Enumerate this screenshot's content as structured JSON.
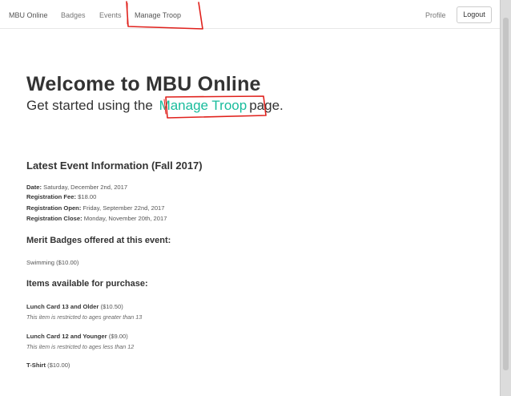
{
  "navbar": {
    "brand": "MBU Online",
    "links": [
      "Badges",
      "Events",
      "Manage Troop"
    ],
    "profile": "Profile",
    "logout": "Logout"
  },
  "jumbotron": {
    "title": "Welcome to MBU Online",
    "subtitle_prefix": "Get started using the",
    "subtitle_link": "Manage Troop",
    "subtitle_suffix": "page."
  },
  "event": {
    "heading": "Latest Event Information (Fall 2017)",
    "details": [
      {
        "label": "Date:",
        "value": "Saturday, December 2nd, 2017"
      },
      {
        "label": "Registration Fee:",
        "value": "$18.00"
      },
      {
        "label": "Registration Open:",
        "value": "Friday, September 22nd, 2017"
      },
      {
        "label": "Registration Close:",
        "value": "Monday, November 20th, 2017"
      }
    ]
  },
  "badges_section": {
    "heading": "Merit Badges offered at this event:",
    "items": [
      "Swimming ($10.00)"
    ]
  },
  "purchases_section": {
    "heading": "Items available for purchase:",
    "items": [
      {
        "name": "Lunch Card 13 and Older",
        "price": "($10.50)",
        "note": "This item is restricted to ages greater than 13"
      },
      {
        "name": "Lunch Card 12 and Younger",
        "price": "($9.00)",
        "note": "This item is restricted to ages less than 12"
      },
      {
        "name": "T-Shirt",
        "price": "($10.00)",
        "note": ""
      }
    ]
  },
  "colors": {
    "link": "#18bc9c",
    "annotation": "#e0211c",
    "text": "#333333"
  }
}
